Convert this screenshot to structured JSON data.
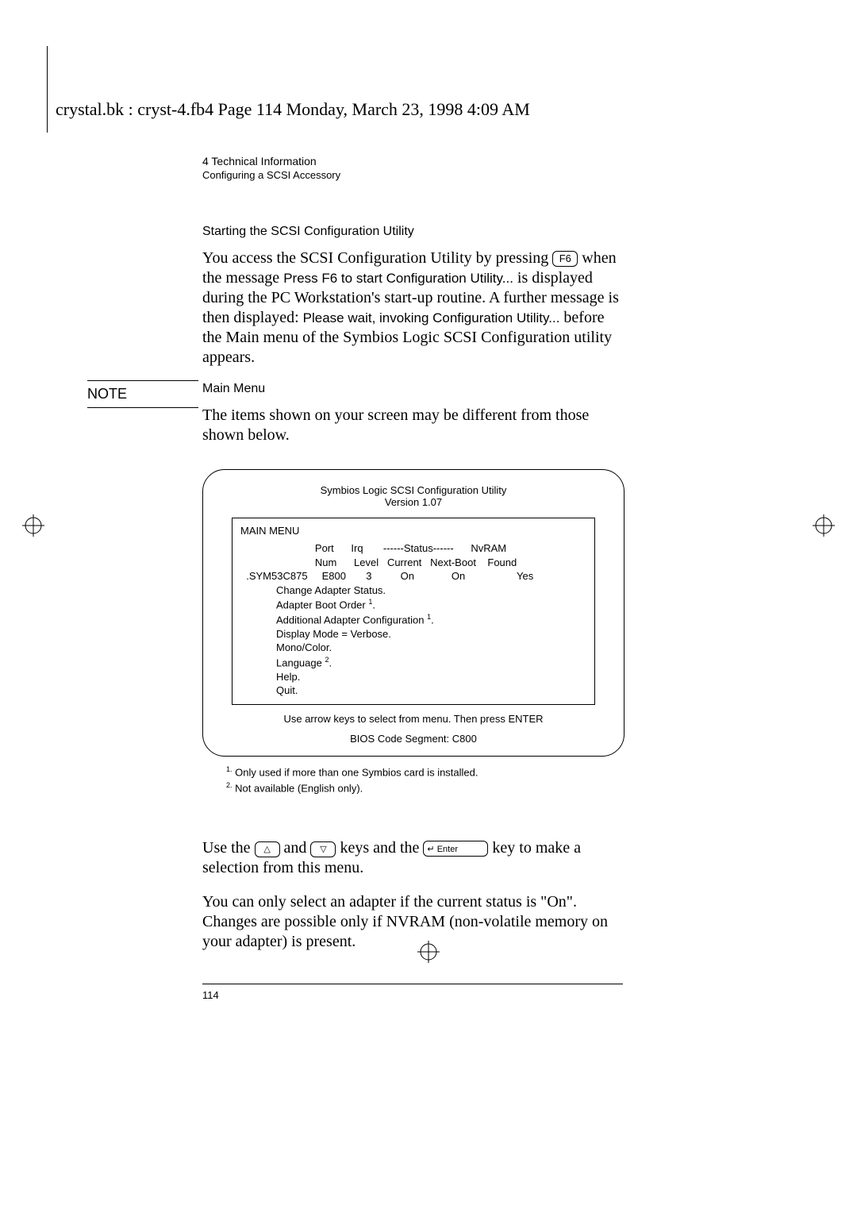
{
  "header_line": "crystal.bk : cryst-4.fb4  Page 114  Monday, March 23, 1998  4:09 AM",
  "running_head": {
    "chapter": "4   Technical Information",
    "section": "Configuring a SCSI Accessory"
  },
  "h_start": "Starting the SCSI Configuration Utility",
  "para1_a": "You access the SCSI Configuration Utility by pressing ",
  "key_f6": "F6",
  "para1_b": " when the message ",
  "msg1": "Press F6 to start Configuration Utility...",
  "para1_c": " is displayed during the PC Workstation's start-up routine. A further message is then displayed: ",
  "msg2": "Please wait, invoking Configuration Utility...",
  "para1_d": " before the Main menu of the Symbios Logic SCSI Configuration utility appears.",
  "h_main": "Main Menu",
  "note_label": "NOTE",
  "para_note": "The items shown on your screen may be different from those shown below.",
  "screen": {
    "title1": "Symbios Logic SCSI Configuration Utility",
    "title2": "Version 1.07",
    "menu_label": "MAIN MENU",
    "hdr1": "                          Port      Irq       ------Status------      NvRAM",
    "hdr2": "                          Num      Level   Current   Next-Boot    Found",
    "row": "  .SYM53C875     E800       3          On             On                  Yes",
    "items": {
      "i0": "Change Adapter Status.",
      "i1a": "Adapter Boot Order ",
      "i1s": "1",
      "i1b": ".",
      "i2a": "Additional Adapter Configuration                  ",
      "i2s": "1",
      "i2b": ".",
      "i3": "Display Mode = Verbose.",
      "i4": "Mono/Color.",
      "i5a": "Language ",
      "i5s": "2",
      "i5b": ".",
      "i6": "Help.",
      "i7": "Quit."
    },
    "hint": "Use arrow keys to select from menu. Then press ENTER",
    "seg": "BIOS Code Segment: C800"
  },
  "footnotes": {
    "f1s": "1.",
    "f1": " Only used if more than one Symbios card is installed.",
    "f2s": "2.",
    "f2": " Not available (English only)."
  },
  "para_use_a": "Use the ",
  "key_up": "△",
  "para_use_b": " and ",
  "key_down": "▽",
  "para_use_c": " keys and the ",
  "key_enter": "↵ Enter",
  "para_use_d": " key to make a selection from this menu.",
  "para_last": "You can only select an adapter if the current status is \"On\". Changes are possible only if NVRAM (non-volatile memory on your adapter) is present.",
  "page_number": "114"
}
